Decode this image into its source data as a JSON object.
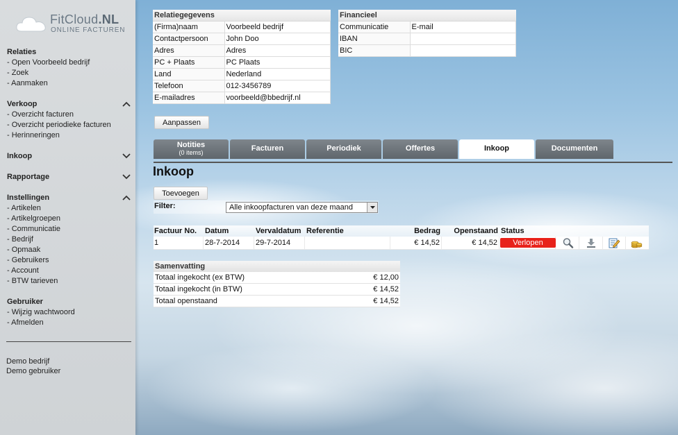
{
  "brand": {
    "name_light": "FitCloud",
    "name_bold": ".NL",
    "tagline": "ONLINE FACTUREN"
  },
  "sidebar": {
    "relaties": {
      "title": "Relaties",
      "items": [
        "- Open Voorbeeld bedrijf",
        "- Zoek",
        "- Aanmaken"
      ]
    },
    "verkoop": {
      "title": "Verkoop",
      "items": [
        "- Overzicht facturen",
        "- Overzicht periodieke facturen",
        "- Herinneringen"
      ]
    },
    "inkoop": {
      "title": "Inkoop"
    },
    "rapportage": {
      "title": "Rapportage"
    },
    "instellingen": {
      "title": "Instellingen",
      "items": [
        "- Artikelen",
        "- Artikelgroepen",
        "- Communicatie",
        "- Bedrijf",
        "- Opmaak",
        "- Gebruikers",
        "- Account",
        "- BTW tarieven"
      ]
    },
    "gebruiker": {
      "title": "Gebruiker",
      "items": [
        "- Wijzig wachtwoord",
        "- Afmelden"
      ]
    },
    "demo_company": "Demo bedrijf",
    "demo_user": "Demo gebruiker"
  },
  "relatie": {
    "title": "Relatiegegevens",
    "rows": [
      {
        "label": "(Firma)naam",
        "value": "Voorbeeld bedrijf"
      },
      {
        "label": "Contactpersoon",
        "value": "John Doo"
      },
      {
        "label": "Adres",
        "value": "Adres"
      },
      {
        "label": "PC + Plaats",
        "value": "PC  Plaats"
      },
      {
        "label": "Land",
        "value": "Nederland"
      },
      {
        "label": "Telefoon",
        "value": "012-3456789"
      },
      {
        "label": "E-mailadres",
        "value": "voorbeeld@bbedrijf.nl"
      }
    ],
    "edit_button": "Aanpassen"
  },
  "financieel": {
    "title": "Financieel",
    "rows": [
      {
        "label": "Communicatie",
        "value": "E-mail"
      },
      {
        "label": "IBAN",
        "value": ""
      },
      {
        "label": "BIC",
        "value": ""
      }
    ]
  },
  "tabs": [
    {
      "label": "Notities",
      "sub": "(0 items)"
    },
    {
      "label": "Facturen"
    },
    {
      "label": "Periodiek"
    },
    {
      "label": "Offertes"
    },
    {
      "label": "Inkoop"
    },
    {
      "label": "Documenten"
    }
  ],
  "active_tab": "Inkoop",
  "main": {
    "title": "Inkoop",
    "add_button": "Toevoegen",
    "filter_label": "Filter:",
    "filter_value": "Alle inkoopfacturen van deze maand"
  },
  "table": {
    "columns": [
      "Factuur No.",
      "Datum",
      "Vervaldatum",
      "Referentie",
      "Bedrag",
      "Openstaand",
      "Status"
    ],
    "rows": [
      {
        "factuur_no": "1",
        "datum": "28-7-2014",
        "vervaldatum": "29-7-2014",
        "referentie": "",
        "bedrag": "€ 14,52",
        "openstaand": "€ 14,52",
        "status": "Verlopen"
      }
    ],
    "status_color": "#e8221a",
    "row_icons": [
      "magnifier-icon",
      "download-icon",
      "edit-icon",
      "coins-icon"
    ]
  },
  "summary": {
    "title": "Samenvatting",
    "rows": [
      {
        "label": "Totaal ingekocht (ex BTW)",
        "value": "€ 12,00"
      },
      {
        "label": "Totaal ingekocht (in BTW)",
        "value": "€ 14,52"
      },
      {
        "label": "Totaal openstaand",
        "value": "€ 14,52"
      }
    ]
  }
}
